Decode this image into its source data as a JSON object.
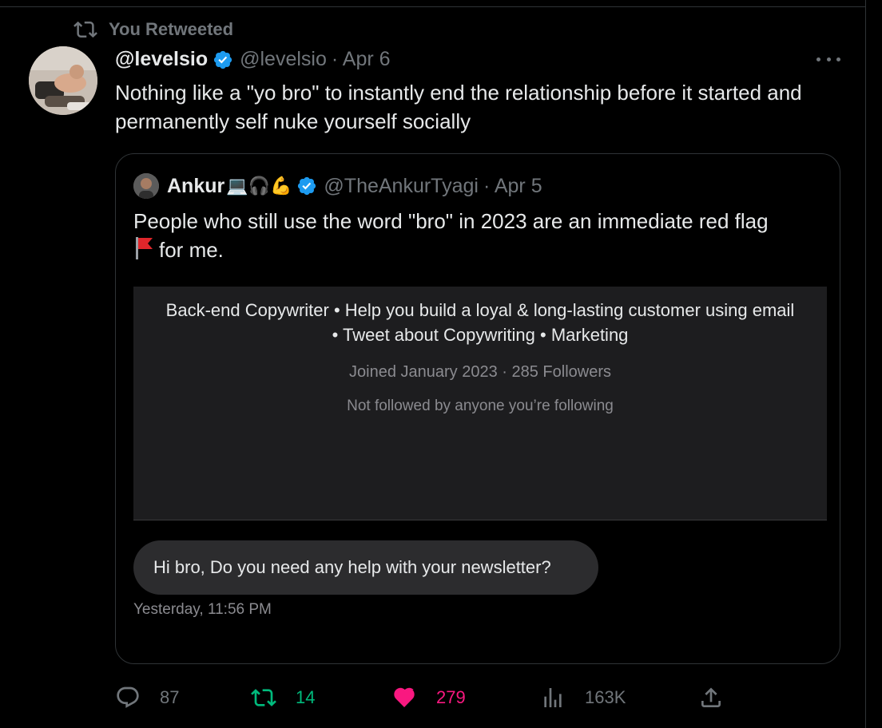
{
  "retweet_banner": {
    "label": "You Retweeted",
    "icon": "retweet-icon"
  },
  "tweet": {
    "name": "@levelsio",
    "handle": "@levelsio",
    "date": "· Apr 6",
    "text": "Nothing like a \"yo bro\" to instantly end the relationship before it started and permanently self nuke yourself socially",
    "more_icon": "more-icon",
    "verified_icon": "verified-badge-icon"
  },
  "quote": {
    "name": "Ankur",
    "name_emojis": "💻🎧💪",
    "handle": "@TheAnkurTyagi",
    "date": "· Apr 5",
    "text_line1": "People who still use the word \"bro\" in 2023 are an immediate red flag",
    "text_line2": "for me.",
    "flag_icon": "red-flag-icon",
    "media": {
      "bio": "Back-end Copywriter • Help you build a loyal & long-lasting customer using email • Tweet about Copywriting • Marketing",
      "joined": "Joined January 2023 · 285 Followers",
      "not_followed": "Not followed by anyone you’re following",
      "dm_message": "Hi bro, Do you need any help with your newsletter?",
      "dm_time": "Yesterday, 11:56 PM"
    }
  },
  "actions": {
    "replies": "87",
    "retweets": "14",
    "likes": "279",
    "views": "163K"
  },
  "colors": {
    "accent_blue": "#1d9bf0",
    "retweet_green": "#00ba7c",
    "like_pink": "#f91880",
    "muted": "#71767b"
  }
}
